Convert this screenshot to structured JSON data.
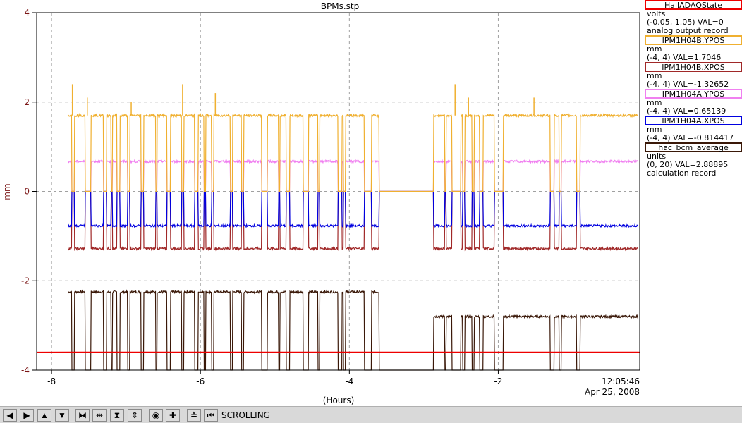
{
  "window": {
    "title": "BPMs.stp"
  },
  "chart_data": {
    "type": "line",
    "title": "BPMs.stp",
    "xlabel": "(Hours)",
    "ylabel": "mm",
    "xlim": [
      -8.2,
      -0.1
    ],
    "ylim": [
      -4,
      4
    ],
    "x_ticks": [
      "-8",
      "-6",
      "-4",
      "-2"
    ],
    "y_ticks": [
      "4",
      "2",
      "0",
      "-2",
      "-4"
    ],
    "time_label": "12:05:46",
    "date_label": "Apr 25, 2008",
    "grid": true,
    "legend_position": "right",
    "series": [
      {
        "name": "HallADAQState",
        "color": "#ee0000",
        "units": "volts",
        "range": "(-0.05, 1.05)",
        "val": "VAL=0",
        "extra": "analog output record",
        "baseline": -3.6,
        "drop": -3.6
      },
      {
        "name": "IPM1H04B.YPOS",
        "color": "#f0b030",
        "units": "mm",
        "range": "(-4, 4)",
        "val": "VAL=1.7046",
        "extra": "",
        "baseline": 1.7,
        "drop": 0.0
      },
      {
        "name": "IPM1H04B.XPOS",
        "color": "#a02828",
        "units": "mm",
        "range": "(-4, 4)",
        "val": "VAL=-1.32652",
        "extra": "",
        "baseline": -1.28,
        "drop": 0.0
      },
      {
        "name": "IPM1H04A.YPOS",
        "color": "#f080f0",
        "units": "mm",
        "range": "(-4, 4)",
        "val": "VAL=0.65139",
        "extra": "",
        "baseline": 0.67,
        "drop": 0.0
      },
      {
        "name": "IPM1H04A.XPOS",
        "color": "#0000e0",
        "units": "mm",
        "range": "(-4, 4)",
        "val": "VAL=-0.814417",
        "extra": "",
        "baseline": -0.77,
        "drop": 0.0
      },
      {
        "name": "hac_bcm_average",
        "color": "#3a1808",
        "units": "units",
        "range": "(0, 20)",
        "val": "VAL=2.88895",
        "extra": "calculation record",
        "baseline": -2.25,
        "baseline_late": -2.8,
        "drop": -4.0
      }
    ],
    "beam_off_intervals": [
      [
        -7.73,
        -7.69
      ],
      [
        -7.55,
        -7.47
      ],
      [
        -7.3,
        -7.26
      ],
      [
        -7.2,
        -7.18
      ],
      [
        -7.12,
        -7.08
      ],
      [
        -6.98,
        -6.95
      ],
      [
        -6.8,
        -6.76
      ],
      [
        -6.6,
        -6.58
      ],
      [
        -6.45,
        -6.4
      ],
      [
        -6.25,
        -6.22
      ],
      [
        -6.08,
        -6.03
      ],
      [
        -5.95,
        -5.93
      ],
      [
        -5.85,
        -5.82
      ],
      [
        -5.6,
        -5.57
      ],
      [
        -5.45,
        -5.42
      ],
      [
        -5.18,
        -5.1
      ],
      [
        -4.95,
        -4.93
      ],
      [
        -4.85,
        -4.8
      ],
      [
        -4.62,
        -4.55
      ],
      [
        -4.42,
        -4.4
      ],
      [
        -4.15,
        -4.1
      ],
      [
        -4.08,
        -4.05
      ],
      [
        -3.8,
        -3.7
      ],
      [
        -3.6,
        -3.45
      ],
      [
        -3.45,
        -3.2
      ],
      [
        -3.2,
        -2.87
      ],
      [
        -2.72,
        -2.7
      ],
      [
        -2.62,
        -2.5
      ],
      [
        -2.48,
        -2.45
      ],
      [
        -2.35,
        -2.32
      ],
      [
        -2.25,
        -2.2
      ],
      [
        -2.05,
        -1.93
      ],
      [
        -1.3,
        -1.25
      ],
      [
        -1.18,
        -1.15
      ],
      [
        -0.95,
        -0.9
      ]
    ],
    "spikes": [
      [
        -7.72,
        2.4
      ],
      [
        -7.52,
        2.1
      ],
      [
        -6.93,
        2.0
      ],
      [
        -6.24,
        2.4
      ],
      [
        -5.8,
        2.2
      ],
      [
        -2.58,
        2.4
      ],
      [
        -2.4,
        2.1
      ],
      [
        -1.52,
        2.1
      ]
    ]
  },
  "toolbar": {
    "buttons": [
      {
        "name": "scroll-left-button",
        "glyph": "◀"
      },
      {
        "name": "scroll-right-button",
        "glyph": "▶"
      },
      {
        "name": "scroll-up-button",
        "glyph": "▲"
      },
      {
        "name": "scroll-down-button",
        "glyph": "▼"
      },
      {
        "name": "compress-horizontal-button",
        "glyph": "⧓"
      },
      {
        "name": "expand-horizontal-button",
        "glyph": "⇹"
      },
      {
        "name": "compress-vertical-button",
        "glyph": "⧗"
      },
      {
        "name": "expand-vertical-button",
        "glyph": "⇕"
      },
      {
        "name": "autoscale-button",
        "glyph": "◉"
      },
      {
        "name": "crosshair-button",
        "glyph": "✚"
      },
      {
        "name": "restore-button",
        "glyph": "≚"
      },
      {
        "name": "stop-scroll-button",
        "glyph": "⏮"
      }
    ],
    "status": "SCROLLING"
  }
}
